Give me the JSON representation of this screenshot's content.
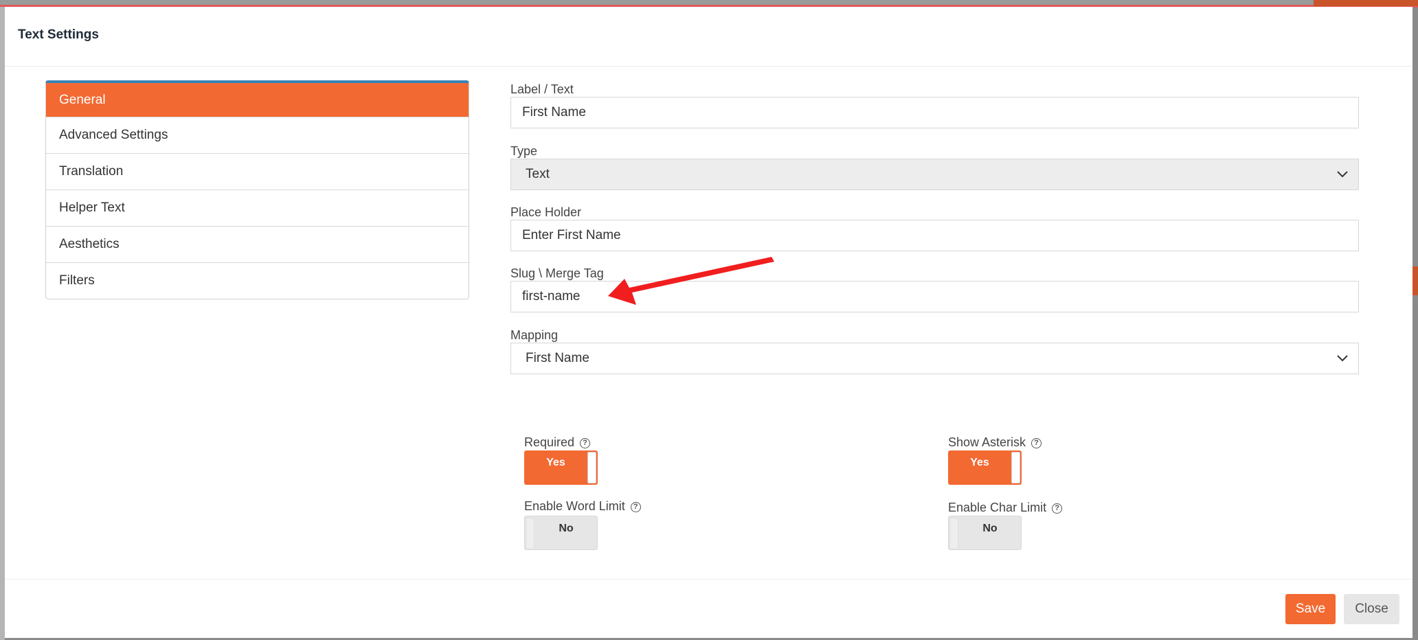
{
  "modal": {
    "title": "Text Settings"
  },
  "tabs": [
    {
      "label": "General",
      "active": true
    },
    {
      "label": "Advanced Settings",
      "active": false
    },
    {
      "label": "Translation",
      "active": false
    },
    {
      "label": "Helper Text",
      "active": false
    },
    {
      "label": "Aesthetics",
      "active": false
    },
    {
      "label": "Filters",
      "active": false
    }
  ],
  "form": {
    "label_text": {
      "label": "Label / Text",
      "value": "First Name"
    },
    "type": {
      "label": "Type",
      "value": "Text"
    },
    "placeholder": {
      "label": "Place Holder",
      "value": "Enter First Name"
    },
    "slug": {
      "label": "Slug \\ Merge Tag",
      "value": "first-name"
    },
    "mapping": {
      "label": "Mapping",
      "value": "First Name"
    }
  },
  "toggles": {
    "required": {
      "label": "Required",
      "value": "Yes",
      "help_icon": "question-circle-icon"
    },
    "show_asterisk": {
      "label": "Show Asterisk",
      "value": "Yes",
      "help_icon": "question-circle-icon"
    },
    "word_limit": {
      "label": "Enable Word Limit",
      "value": "No",
      "help_icon": "question-circle-icon"
    },
    "char_limit": {
      "label": "Enable Char Limit",
      "value": "No",
      "help_icon": "question-circle-icon"
    }
  },
  "footer": {
    "save_label": "Save",
    "close_label": "Close"
  },
  "colors": {
    "accent": "#f36932",
    "tab_top_border": "#3b82b5",
    "annotation_arrow": "#f01e1e"
  },
  "annotation": {
    "icon": "red-arrow-annotation"
  }
}
